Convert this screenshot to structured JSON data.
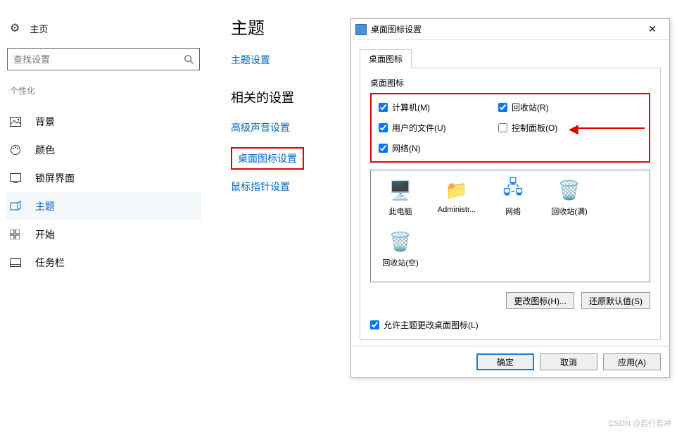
{
  "sidebar": {
    "home": "主页",
    "search_placeholder": "查找设置",
    "section": "个性化",
    "items": [
      {
        "label": "背景"
      },
      {
        "label": "颜色"
      },
      {
        "label": "锁屏界面"
      },
      {
        "label": "主题"
      },
      {
        "label": "开始"
      },
      {
        "label": "任务栏"
      }
    ]
  },
  "mid": {
    "title": "主题",
    "theme_link": "主题设置",
    "related_title": "相关的设置",
    "links": [
      "高级声音设置",
      "桌面图标设置",
      "鼠标指针设置"
    ]
  },
  "dialog": {
    "title": "桌面图标设置",
    "tab": "桌面图标",
    "group_label": "桌面图标",
    "checkboxes": {
      "computer": {
        "label": "计算机(M)",
        "checked": true
      },
      "recycle": {
        "label": "回收站(R)",
        "checked": true
      },
      "userfiles": {
        "label": "用户的文件(U)",
        "checked": true
      },
      "control": {
        "label": "控制面板(O)",
        "checked": false
      },
      "network": {
        "label": "网络(N)",
        "checked": true
      }
    },
    "icons": [
      "此电脑",
      "Administr...",
      "网络",
      "回收站(满)",
      "回收站(空)"
    ],
    "change_icon": "更改图标(H)...",
    "restore_default": "还原默认值(S)",
    "allow_theme": "允许主题更改桌面图标(L)",
    "allow_theme_checked": true,
    "ok": "确定",
    "cancel": "取消",
    "apply": "应用(A)"
  },
  "watermark": "CSDN @若行若冲"
}
